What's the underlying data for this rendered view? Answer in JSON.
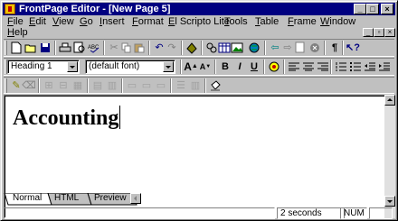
{
  "window": {
    "title": "FrontPage Editor - [New Page 5]"
  },
  "menu": [
    "File",
    "Edit",
    "View",
    "Go",
    "Insert",
    "Format",
    "El Scripto Lite",
    "Tools",
    "Table",
    "Frame",
    "Window",
    "Help"
  ],
  "format": {
    "style_value": "Heading 1",
    "font_value": "(default font)"
  },
  "format_buttons": {
    "bold": "B",
    "italic": "I",
    "underline": "U"
  },
  "document": {
    "text": "Accounting"
  },
  "tabs": [
    "Normal",
    "HTML",
    "Preview"
  ],
  "status": {
    "time": "2 seconds",
    "num": "NUM"
  },
  "colors": {
    "titlebar": "#000080",
    "face": "#c0c0c0"
  }
}
